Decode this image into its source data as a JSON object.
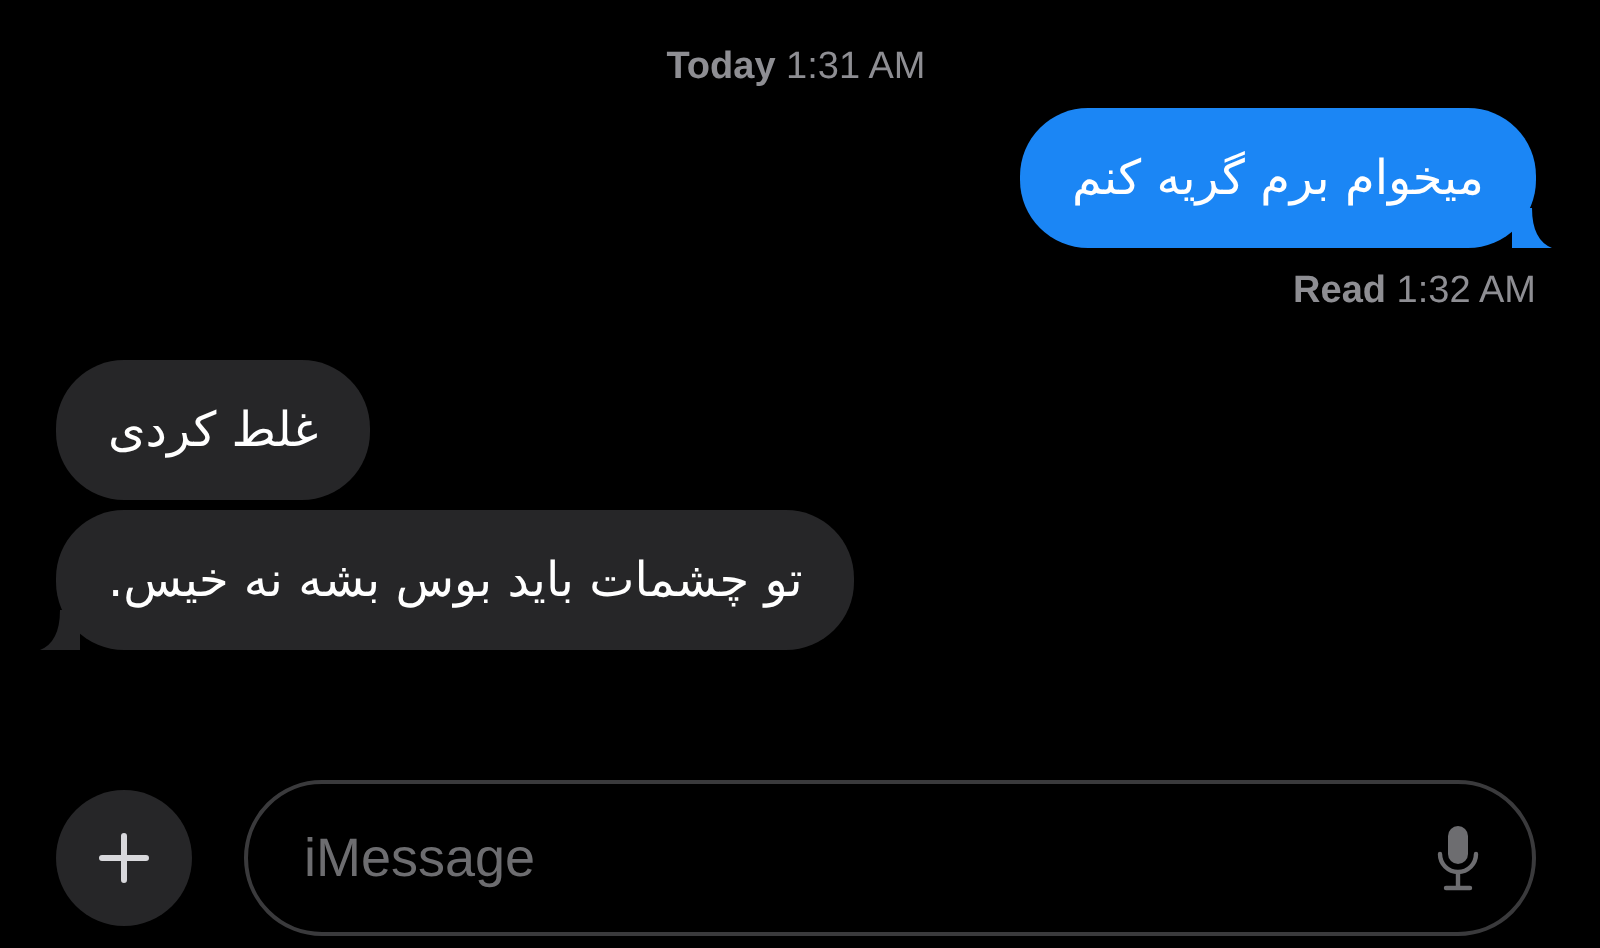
{
  "header": {
    "timestamp": "**Today** 1:31 AM"
  },
  "messages": [
    {
      "kind": "sent",
      "text": "میخوام برم گریه کنم",
      "tail": true
    },
    {
      "kind": "receipt",
      "text": "**Read** 1:32 AM"
    },
    {
      "kind": "received",
      "text": "غلط کردی",
      "tail": false
    },
    {
      "kind": "received",
      "text": "تو چشمات باید بوس بشه نه خیس.",
      "tail": true
    }
  ],
  "composer": {
    "placeholder": "iMessage"
  }
}
